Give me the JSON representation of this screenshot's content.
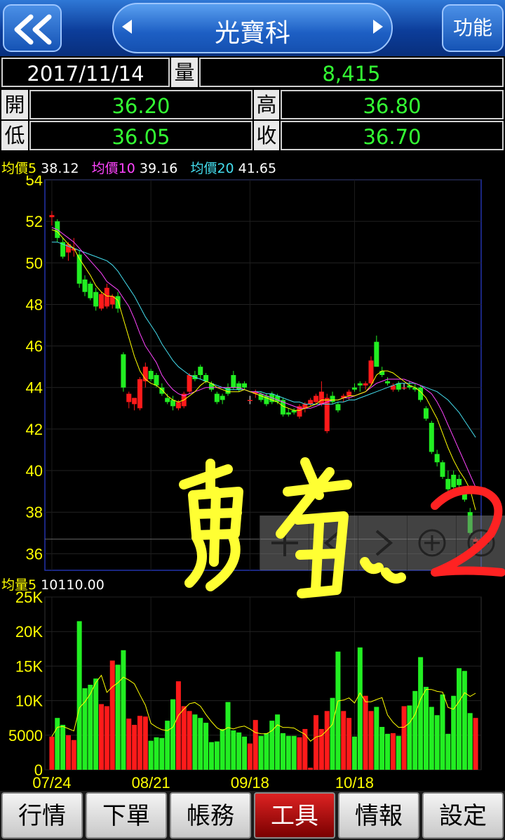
{
  "header": {
    "title": "光寶科",
    "func_label": "功能"
  },
  "quote": {
    "date": "2017/11/14",
    "volume_label": "量",
    "volume": "8,415",
    "open_label": "開",
    "open": "36.20",
    "high_label": "高",
    "high": "36.80",
    "low_label": "低",
    "low": "36.05",
    "close_label": "收",
    "close": "36.70"
  },
  "ma_legend": {
    "ma5_label": "均價5",
    "ma5": "38.12",
    "ma10_label": "均價10",
    "ma10": "39.16",
    "ma20_label": "均價20",
    "ma20": "41.65"
  },
  "vol_legend": {
    "label": "均量5",
    "value": "10110.00"
  },
  "annotation": "勇者、2",
  "colors": {
    "up": "#ff1a1a",
    "down": "#22ee22",
    "ma5": "#ffff00",
    "ma10": "#ff44ff",
    "ma20": "#44ddee",
    "axis_text": "#ffff00"
  },
  "tools": [
    "crosshair-icon",
    "previous-icon",
    "next-icon",
    "zoom-in-icon",
    "zoom-out-icon"
  ],
  "tabs": [
    {
      "label": "行情",
      "active": false
    },
    {
      "label": "下單",
      "active": false
    },
    {
      "label": "帳務",
      "active": false
    },
    {
      "label": "工具",
      "active": true
    },
    {
      "label": "情報",
      "active": false
    },
    {
      "label": "設定",
      "active": false
    }
  ],
  "chart_data": [
    {
      "type": "candlestick",
      "y_ticks": [
        "54",
        "52",
        "50",
        "48",
        "46",
        "44",
        "42",
        "40",
        "38",
        "36"
      ],
      "ylim": [
        35.2,
        54
      ],
      "x_labels": [
        "07/24",
        "08/21",
        "09/18",
        "10/18"
      ],
      "candles": [
        [
          52.2,
          52.5,
          51.8,
          52.3
        ],
        [
          52.0,
          52.1,
          51.0,
          51.2
        ],
        [
          51.0,
          51.2,
          50.2,
          50.3
        ],
        [
          50.5,
          51.0,
          50.1,
          50.9
        ],
        [
          50.6,
          51.2,
          50.3,
          50.7
        ],
        [
          50.4,
          50.6,
          48.8,
          49.0
        ],
        [
          49.2,
          49.4,
          48.4,
          48.6
        ],
        [
          49.0,
          49.1,
          48.2,
          48.3
        ],
        [
          48.6,
          48.8,
          47.7,
          47.9
        ],
        [
          47.8,
          48.6,
          47.7,
          48.5
        ],
        [
          47.9,
          49.0,
          47.8,
          48.8
        ],
        [
          48.0,
          48.5,
          47.8,
          48.4
        ],
        [
          48.4,
          48.6,
          47.6,
          47.8
        ],
        [
          45.6,
          45.7,
          43.8,
          44.0
        ],
        [
          43.3,
          43.8,
          43.0,
          43.7
        ],
        [
          43.2,
          43.5,
          42.9,
          43.5
        ],
        [
          43.0,
          44.5,
          42.9,
          44.4
        ],
        [
          44.3,
          45.2,
          44.0,
          45.0
        ],
        [
          44.8,
          44.9,
          44.3,
          44.4
        ],
        [
          44.6,
          44.7,
          44.0,
          44.1
        ],
        [
          44.0,
          44.2,
          43.6,
          43.7
        ],
        [
          43.5,
          43.7,
          43.2,
          43.3
        ],
        [
          43.4,
          43.6,
          42.9,
          43.1
        ],
        [
          43.0,
          43.4,
          42.9,
          43.3
        ],
        [
          43.1,
          43.8,
          43.0,
          43.7
        ],
        [
          43.8,
          44.7,
          43.7,
          44.6
        ],
        [
          44.6,
          44.8,
          44.3,
          44.4
        ],
        [
          45.0,
          45.1,
          44.4,
          44.6
        ],
        [
          44.6,
          44.7,
          44.2,
          44.3
        ],
        [
          44.2,
          44.3,
          43.8,
          43.9
        ],
        [
          43.7,
          43.8,
          43.2,
          43.3
        ],
        [
          43.6,
          43.7,
          43.2,
          43.4
        ],
        [
          44.0,
          44.2,
          43.6,
          43.7
        ],
        [
          44.6,
          44.8,
          43.9,
          44.0
        ],
        [
          44.2,
          44.3,
          43.8,
          43.9
        ],
        [
          44.2,
          44.3,
          43.9,
          44.0
        ],
        [
          43.4,
          43.6,
          43.2,
          43.4
        ],
        [
          43.7,
          43.9,
          43.5,
          43.8
        ],
        [
          43.7,
          43.8,
          43.3,
          43.4
        ],
        [
          43.6,
          43.7,
          43.1,
          43.2
        ],
        [
          43.7,
          43.8,
          43.2,
          43.3
        ],
        [
          43.6,
          43.7,
          43.2,
          43.3
        ],
        [
          43.4,
          43.5,
          42.6,
          42.7
        ],
        [
          42.8,
          43.0,
          42.6,
          42.7
        ],
        [
          42.9,
          43.0,
          42.7,
          42.8
        ],
        [
          42.6,
          43.2,
          42.5,
          43.1
        ],
        [
          43.0,
          43.3,
          42.8,
          43.2
        ],
        [
          43.2,
          43.5,
          43.1,
          43.4
        ],
        [
          43.3,
          43.7,
          43.2,
          43.6
        ],
        [
          43.2,
          44.3,
          43.1,
          43.8
        ],
        [
          41.9,
          43.7,
          41.8,
          43.5
        ],
        [
          43.6,
          43.8,
          43.2,
          43.3
        ],
        [
          43.2,
          43.3,
          42.8,
          42.9
        ],
        [
          43.5,
          43.7,
          43.3,
          43.6
        ],
        [
          43.6,
          43.9,
          43.4,
          43.8
        ],
        [
          44.0,
          44.2,
          43.8,
          43.9
        ],
        [
          44.2,
          44.3,
          43.8,
          44.1
        ],
        [
          44.1,
          44.3,
          43.9,
          44.2
        ],
        [
          44.2,
          45.5,
          44.1,
          45.3
        ],
        [
          46.2,
          46.5,
          45.0,
          45.0
        ],
        [
          44.8,
          45.0,
          44.5,
          44.6
        ],
        [
          44.3,
          44.5,
          44.1,
          44.2
        ],
        [
          43.9,
          44.2,
          43.8,
          44.1
        ],
        [
          44.2,
          44.3,
          43.8,
          43.9
        ],
        [
          44.0,
          44.2,
          43.9,
          44.0
        ],
        [
          44.1,
          44.3,
          43.9,
          44.0
        ],
        [
          44.0,
          44.2,
          43.8,
          43.9
        ],
        [
          44.0,
          44.1,
          43.3,
          43.4
        ],
        [
          43.0,
          43.1,
          42.4,
          42.5
        ],
        [
          42.3,
          42.4,
          40.8,
          40.9
        ],
        [
          40.8,
          41.0,
          40.2,
          40.4
        ],
        [
          40.4,
          40.5,
          39.6,
          39.7
        ],
        [
          39.6,
          40.0,
          38.9,
          39.1
        ],
        [
          39.8,
          40.0,
          39.0,
          39.2
        ],
        [
          39.6,
          39.8,
          39.0,
          39.3
        ],
        [
          38.9,
          39.0,
          38.5,
          38.6
        ],
        [
          38.0,
          38.2,
          36.9,
          37.0
        ],
        [
          36.2,
          36.8,
          36.05,
          36.7
        ]
      ],
      "ma5": [
        51.6,
        51.5,
        51.2,
        50.9,
        50.7,
        50.2,
        49.8,
        49.4,
        48.9,
        48.6,
        48.4,
        48.4,
        48.2,
        47.3,
        46.4,
        45.5,
        44.8,
        44.4,
        44.2,
        44.1,
        43.9,
        43.6,
        43.4,
        43.3,
        43.4,
        43.6,
        43.8,
        44.1,
        44.3,
        44.2,
        44.0,
        43.9,
        43.8,
        43.8,
        43.8,
        43.9,
        43.8,
        43.7,
        43.6,
        43.5,
        43.4,
        43.3,
        43.1,
        43.0,
        42.9,
        42.9,
        43.0,
        43.1,
        43.2,
        43.4,
        43.4,
        43.4,
        43.4,
        43.5,
        43.6,
        43.6,
        43.7,
        43.8,
        44.1,
        44.6,
        44.8,
        44.8,
        44.7,
        44.5,
        44.3,
        44.1,
        44.0,
        43.8,
        43.5,
        43.0,
        42.5,
        41.8,
        41.1,
        40.5,
        40.0,
        39.6,
        39.1,
        38.1
      ],
      "ma10": [
        51.7,
        51.6,
        51.4,
        51.2,
        51.0,
        50.7,
        50.4,
        50.1,
        49.8,
        49.5,
        49.1,
        48.9,
        48.7,
        48.3,
        47.9,
        47.3,
        46.6,
        46.0,
        45.6,
        45.2,
        44.6,
        44.2,
        43.9,
        43.7,
        43.6,
        43.7,
        43.8,
        43.9,
        44.0,
        44.0,
        44.0,
        44.0,
        44.0,
        44.0,
        44.0,
        43.9,
        43.8,
        43.8,
        43.7,
        43.6,
        43.5,
        43.4,
        43.3,
        43.2,
        43.1,
        43.0,
        43.0,
        43.0,
        43.1,
        43.2,
        43.3,
        43.4,
        43.4,
        43.5,
        43.5,
        43.6,
        43.7,
        43.8,
        44.0,
        44.2,
        44.3,
        44.4,
        44.4,
        44.4,
        44.4,
        44.3,
        44.2,
        44.1,
        43.9,
        43.7,
        43.3,
        42.8,
        42.2,
        41.6,
        41.0,
        40.4,
        39.8,
        39.2
      ],
      "ma20": [
        51.0,
        51.0,
        50.9,
        50.8,
        50.7,
        50.6,
        50.5,
        50.4,
        50.3,
        50.2,
        50.1,
        49.9,
        49.6,
        49.2,
        48.8,
        48.4,
        47.9,
        47.4,
        47.0,
        46.6,
        46.1,
        45.7,
        45.3,
        45.0,
        44.8,
        44.6,
        44.5,
        44.4,
        44.3,
        44.2,
        44.1,
        44.0,
        43.9,
        43.9,
        43.9,
        43.9,
        43.8,
        43.8,
        43.8,
        43.7,
        43.7,
        43.6,
        43.5,
        43.4,
        43.3,
        43.3,
        43.2,
        43.2,
        43.2,
        43.2,
        43.2,
        43.2,
        43.3,
        43.3,
        43.4,
        43.4,
        43.5,
        43.6,
        43.7,
        43.8,
        43.9,
        44.0,
        44.1,
        44.2,
        44.2,
        44.2,
        44.2,
        44.1,
        44.0,
        43.9,
        43.8,
        43.6,
        43.4,
        43.1,
        42.8,
        42.4,
        42.0,
        41.6
      ]
    },
    {
      "type": "bar",
      "y_ticks": [
        "25K",
        "20K",
        "15K",
        "10K",
        "5000",
        "0"
      ],
      "ylim": [
        0,
        25000
      ],
      "x_labels": [
        "07/24",
        "08/21",
        "09/18",
        "10/18"
      ],
      "values": [
        4800,
        7500,
        6500,
        5000,
        4300,
        21500,
        11800,
        12300,
        13200,
        9500,
        9200,
        15800,
        15200,
        17300,
        7400,
        6500,
        7800,
        7700,
        4200,
        4700,
        4600,
        7100,
        10200,
        12800,
        9200,
        8500,
        8000,
        7500,
        6800,
        4000,
        4100,
        5900,
        9800,
        5700,
        5400,
        4800,
        3800,
        7200,
        4900,
        5300,
        7100,
        8000,
        5300,
        4900,
        4900,
        4700,
        5900,
        300,
        7900,
        5900,
        8500,
        10400,
        17100,
        8500,
        7500,
        4800,
        17700,
        10700,
        8500,
        9100,
        6200,
        5200,
        5300,
        4900,
        9200,
        9300,
        11400,
        16300,
        12000,
        9100,
        7900,
        10900,
        5200,
        10700,
        14700,
        14300,
        8200,
        7500
      ]
    }
  ]
}
